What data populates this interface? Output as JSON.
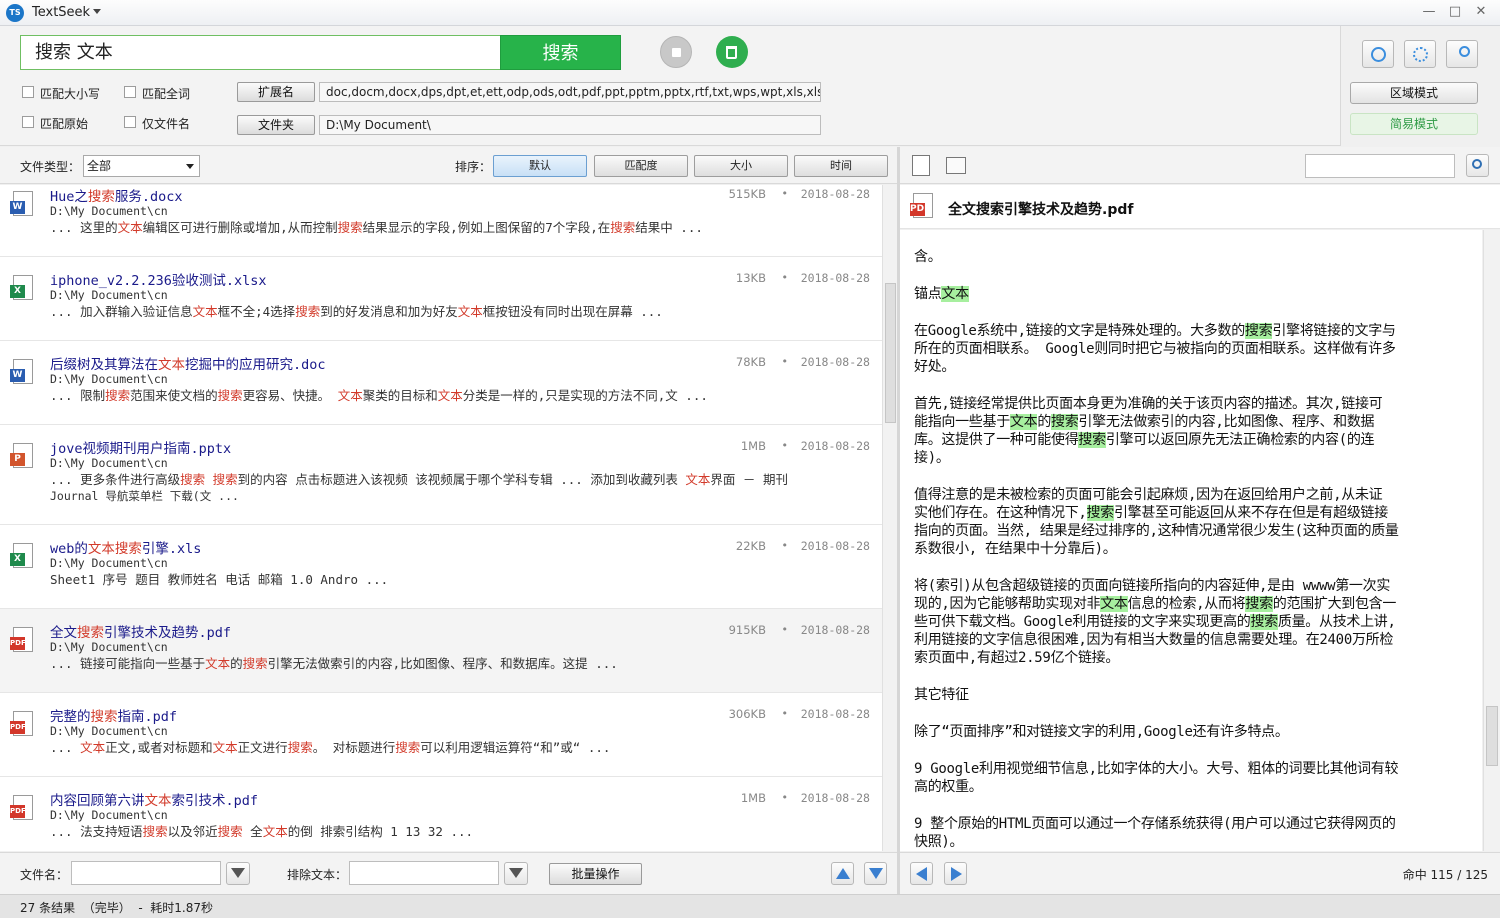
{
  "app": {
    "title": "TextSeek",
    "logo_text": "TS"
  },
  "window": {
    "minimize": "—",
    "maximize": "□",
    "close": "✕"
  },
  "search": {
    "query": "搜索  文本",
    "button_label": "搜索"
  },
  "options": {
    "match_case": "匹配大小写",
    "match_whole_word": "匹配全词",
    "match_original": "匹配原始",
    "filename_only": "仅文件名",
    "ext_button": "扩展名",
    "ext_value": "doc,docm,docx,dps,dpt,et,ett,odp,ods,odt,pdf,ppt,pptm,pptx,rtf,txt,wps,wpt,xls,xlsm,xlsx",
    "folder_button": "文件夹",
    "folder_value": "D:\\My Document\\"
  },
  "modes": {
    "area_mode": "区域模式",
    "simple_mode": "简易模式"
  },
  "filter": {
    "file_type_label": "文件类型：",
    "file_type_value": "全部",
    "sort_label": "排序：",
    "sort_buttons": [
      "默认",
      "匹配度",
      "大小",
      "时间"
    ]
  },
  "results": [
    {
      "type": "docx",
      "name": [
        [
          "Hue之",
          0
        ],
        [
          "搜索",
          1
        ],
        [
          "服务.docx",
          0
        ]
      ],
      "path": "D:\\My Document\\cn",
      "size": "515KB",
      "date": "2018-08-28",
      "snippet": [
        [
          [
            "... 这里的",
            0
          ],
          [
            "文本",
            1
          ],
          [
            "编辑区可进行删除或增加,从而控制",
            0
          ],
          [
            "搜索",
            1
          ],
          [
            "结果显示的字段,例如上图保留的7个字段,在",
            0
          ],
          [
            "搜索",
            1
          ],
          [
            "结果中 ...",
            0
          ]
        ]
      ]
    },
    {
      "type": "xlsx",
      "name": [
        [
          "iphone_v2.2.236验收测试.xlsx",
          0
        ]
      ],
      "path": "D:\\My Document\\cn",
      "size": "13KB",
      "date": "2018-08-28",
      "snippet": [
        [
          [
            "... 加入群输入验证信息",
            0
          ],
          [
            "文本",
            1
          ],
          [
            "框不全;4选择",
            0
          ],
          [
            "搜索",
            1
          ],
          [
            "到的好发消息和加为好友",
            0
          ],
          [
            "文本",
            1
          ],
          [
            "框按钮没有同时出现在屏幕 ...",
            0
          ]
        ]
      ]
    },
    {
      "type": "doc",
      "name": [
        [
          "后缀树及其算法在",
          0
        ],
        [
          "文本",
          1
        ],
        [
          "挖掘中的应用研究.doc",
          0
        ]
      ],
      "path": "D:\\My Document\\cn",
      "size": "78KB",
      "date": "2018-08-28",
      "snippet": [
        [
          [
            "... 限制",
            0
          ],
          [
            "搜索",
            1
          ],
          [
            "范围来使文档的",
            0
          ],
          [
            "搜索",
            1
          ],
          [
            "更容易、快捷。 ",
            0
          ],
          [
            "文本",
            1
          ],
          [
            "聚类的目标和",
            0
          ],
          [
            "文本",
            1
          ],
          [
            "分类是一样的,只是实现的方法不同,文 ...",
            0
          ]
        ]
      ]
    },
    {
      "type": "pptx",
      "name": [
        [
          "jove视频期刊用户指南.pptx",
          0
        ]
      ],
      "path": "D:\\My Document\\cn",
      "size": "1MB",
      "date": "2018-08-28",
      "snippet": [
        [
          [
            "... 更多条件进行高级",
            0
          ],
          [
            "搜索",
            1
          ],
          [
            " ",
            0
          ],
          [
            "搜索",
            1
          ],
          [
            "到的内容 点击标题进入该视频 该视频属于哪个学科专辑 ... 添加到收藏列表 ",
            0
          ],
          [
            "文本",
            1
          ],
          [
            "界面 － 期刊",
            0
          ]
        ],
        [
          [
            "Journal 导航菜单栏 下载(文 ...",
            0
          ]
        ]
      ]
    },
    {
      "type": "xls",
      "name": [
        [
          "web的",
          0
        ],
        [
          "文本搜索",
          1
        ],
        [
          "引擎.xls",
          0
        ]
      ],
      "path": "D:\\My Document\\cn",
      "size": "22KB",
      "date": "2018-08-28",
      "snippet": [
        [
          [
            "Sheet1 序号 题目 教师姓名 电话 邮箱 1.0 Andro ...",
            0
          ]
        ]
      ]
    },
    {
      "type": "pdf",
      "name": [
        [
          "全文",
          0
        ],
        [
          "搜索",
          1
        ],
        [
          "引擎技术及趋势.pdf",
          0
        ]
      ],
      "path": "D:\\My Document\\cn",
      "size": "915KB",
      "date": "2018-08-28",
      "selected": true,
      "snippet": [
        [
          [
            "... 链接可能指向一些基于",
            0
          ],
          [
            "文本",
            1
          ],
          [
            "的",
            0
          ],
          [
            "搜索",
            1
          ],
          [
            "引擎无法做索引的内容,比如图像、程序、和数据库。这提 ...",
            0
          ]
        ]
      ]
    },
    {
      "type": "pdf",
      "name": [
        [
          "完整的",
          0
        ],
        [
          "搜索",
          1
        ],
        [
          "指南.pdf",
          0
        ]
      ],
      "path": "D:\\My Document\\cn",
      "size": "306KB",
      "date": "2018-08-28",
      "snippet": [
        [
          [
            "... ",
            0
          ],
          [
            "文本",
            1
          ],
          [
            "正文,或者对标题和",
            0
          ],
          [
            "文本",
            1
          ],
          [
            "正文进行",
            0
          ],
          [
            "搜索",
            1
          ],
          [
            "。 对标题进行",
            0
          ],
          [
            "搜索",
            1
          ],
          [
            "可以利用逻辑运算符“和”或“ ...",
            0
          ]
        ]
      ]
    },
    {
      "type": "pdf",
      "name": [
        [
          "内容回顾第六讲",
          0
        ],
        [
          "文本",
          1
        ],
        [
          "索引技术.pdf",
          0
        ]
      ],
      "path": "D:\\My Document\\cn",
      "size": "1MB",
      "date": "2018-08-28",
      "snippet": [
        [
          [
            "... 法支持短语",
            0
          ],
          [
            "搜索",
            1
          ],
          [
            "以及邻近",
            0
          ],
          [
            "搜索",
            1
          ],
          [
            " 全",
            0
          ],
          [
            "文本",
            1
          ],
          [
            "的倒 排索引结构 1 13 32 ...",
            0
          ]
        ]
      ]
    }
  ],
  "preview": {
    "title": "全文搜索引擎技术及趋势.pdf",
    "lines": [
      [
        [
          "含。",
          0
        ]
      ],
      [],
      [
        [
          " 锚点",
          0
        ],
        [
          "文本",
          1
        ]
      ],
      [],
      [
        [
          " 在Google系统中,链接的文字是特殊处理的。大多数的",
          0
        ],
        [
          "搜索",
          1
        ],
        [
          "引擎将链接的文字与",
          0
        ]
      ],
      [
        [
          "所在的页面相联系。 Google则同时把它与被指向的页面相联系。这样做有许多",
          0
        ]
      ],
      [
        [
          "好处。",
          0
        ]
      ],
      [],
      [
        [
          " 首先,链接经常提供比页面本身更为准确的关于该页内容的描述。其次,链接可",
          0
        ]
      ],
      [
        [
          "能指向一些基于",
          0
        ],
        [
          "文本",
          1
        ],
        [
          "的",
          0
        ],
        [
          "搜索",
          1
        ],
        [
          "引擎无法做索引的内容,比如图像、程序、和数据",
          0
        ]
      ],
      [
        [
          "库。这提供了一种可能使得",
          0
        ],
        [
          "搜索",
          1
        ],
        [
          "引擎可以返回原先无法正确检索的内容(的连",
          0
        ]
      ],
      [
        [
          "接)。",
          0
        ]
      ],
      [],
      [
        [
          " 值得注意的是未被检索的页面可能会引起麻烦,因为在返回给用户之前,从未证",
          0
        ]
      ],
      [
        [
          "实他们存在。在这种情况下,",
          0
        ],
        [
          "搜索",
          1
        ],
        [
          "引擎甚至可能返回从来不存在但是有超级链接",
          0
        ]
      ],
      [
        [
          "指向的页面。当然, 结果是经过排序的,这种情况通常很少发生(这种页面的质量",
          0
        ]
      ],
      [
        [
          "系数很小, 在结果中十分靠后)。",
          0
        ]
      ],
      [],
      [
        [
          " 将(索引)从包含超级链接的页面向链接所指向的内容延伸,是由 wwww第一次实",
          0
        ]
      ],
      [
        [
          "现的,因为它能够帮助实现对非",
          0
        ],
        [
          "文本",
          1
        ],
        [
          "信息的检索,从而将",
          0
        ],
        [
          "搜索",
          1
        ],
        [
          "的范围扩大到包含一",
          0
        ]
      ],
      [
        [
          "些可供下载文档。Google利用链接的文字来实现更高的",
          0
        ],
        [
          "搜索",
          1
        ],
        [
          "质量。从技术上讲,",
          0
        ]
      ],
      [
        [
          "利用链接的文字信息很困难,因为有相当大数量的信息需要处理。在2400万所检",
          0
        ]
      ],
      [
        [
          "索页面中,有超过2.59亿个链接。",
          0
        ]
      ],
      [],
      [
        [
          "其它特征",
          0
        ]
      ],
      [],
      [
        [
          " 除了“页面排序”和对链接文字的利用,Google还有许多特点。",
          0
        ]
      ],
      [],
      [
        [
          "9 Google利用视觉细节信息,比如字体的大小。大号、粗体的词要比其他词有较",
          0
        ]
      ],
      [
        [
          "高的权重。",
          0
        ]
      ],
      [],
      [
        [
          "9 整个原始的HTML页面可以通过一个存储系统获得(用户可以通过它获得网页的",
          0
        ]
      ],
      [
        [
          "快照)。",
          0
        ]
      ]
    ]
  },
  "bottom": {
    "filename_label": "文件名：",
    "exclude_label": "排除文本：",
    "batch_button": "批量操作",
    "hit_count": "命中 115 / 125"
  },
  "status": {
    "text": "27 条结果  （完毕）  -  耗时1.87秒"
  },
  "colors": {
    "accent": "#27b34a",
    "highlight_text": "#d23a2a",
    "highlight_bg": "#a7ef9f",
    "link": "#1a1a8a"
  }
}
